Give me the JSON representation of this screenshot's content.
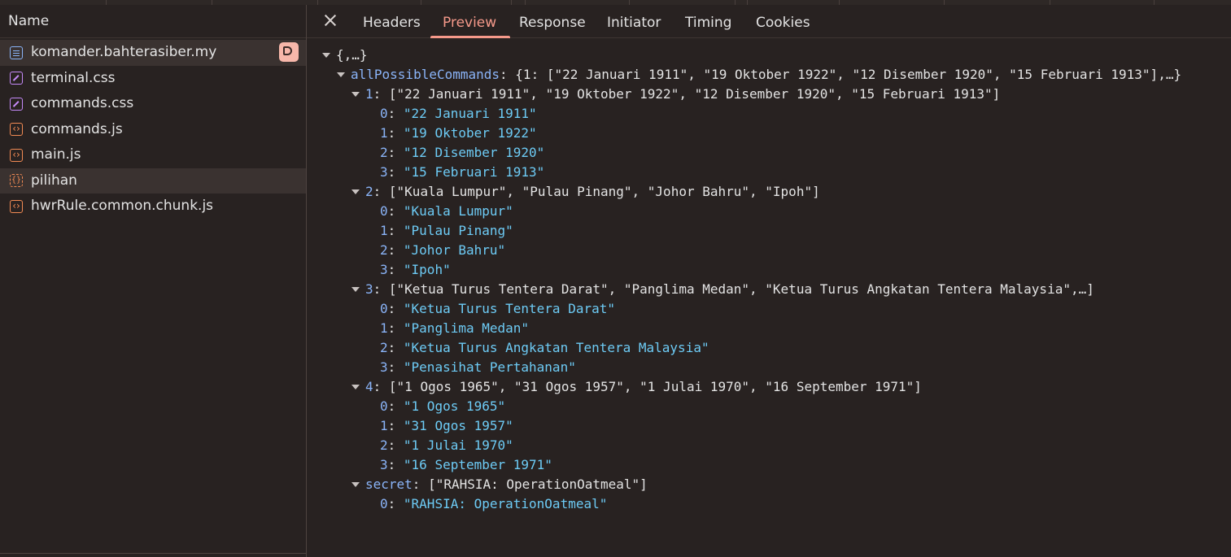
{
  "left_panel": {
    "header": "Name",
    "files": [
      {
        "name": "komander.bahterasiber.my",
        "type": "doc-icon"
      },
      {
        "name": "terminal.css",
        "type": "css-icon"
      },
      {
        "name": "commands.css",
        "type": "css-icon"
      },
      {
        "name": "commands.js",
        "type": "js-icon"
      },
      {
        "name": "main.js",
        "type": "js-icon"
      },
      {
        "name": "pilihan",
        "type": "json-icon"
      },
      {
        "name": "hwrRule.common.chunk.js",
        "type": "js-icon"
      }
    ]
  },
  "tabs": [
    "Headers",
    "Preview",
    "Response",
    "Initiator",
    "Timing",
    "Cookies"
  ],
  "active_tab": "Preview",
  "preview": {
    "root": "{,…}",
    "root_key": "allPossibleCommands",
    "root_summary": "{1: [\"22 Januari 1911\", \"19 Oktober 1922\", \"12 Disember 1920\", \"15 Februari 1913\"],…}",
    "groups": [
      {
        "key": "1",
        "summary": "[\"22 Januari 1911\", \"19 Oktober 1922\", \"12 Disember 1920\", \"15 Februari 1913\"]",
        "items": [
          "\"22 Januari 1911\"",
          "\"19 Oktober 1922\"",
          "\"12 Disember 1920\"",
          "\"15 Februari 1913\""
        ]
      },
      {
        "key": "2",
        "summary": "[\"Kuala Lumpur\", \"Pulau Pinang\", \"Johor Bahru\", \"Ipoh\"]",
        "items": [
          "\"Kuala Lumpur\"",
          "\"Pulau Pinang\"",
          "\"Johor Bahru\"",
          "\"Ipoh\""
        ]
      },
      {
        "key": "3",
        "summary": "[\"Ketua Turus Tentera Darat\", \"Panglima Medan\", \"Ketua Turus Angkatan Tentera Malaysia\",…]",
        "items": [
          "\"Ketua Turus Tentera Darat\"",
          "\"Panglima Medan\"",
          "\"Ketua Turus Angkatan Tentera Malaysia\"",
          "\"Penasihat Pertahanan\""
        ]
      },
      {
        "key": "4",
        "summary": "[\"1 Ogos 1965\", \"31 Ogos 1957\", \"1 Julai 1970\", \"16 September 1971\"]",
        "items": [
          "\"1 Ogos 1965\"",
          "\"31 Ogos 1957\"",
          "\"1 Julai 1970\"",
          "\"16 September 1971\""
        ]
      }
    ],
    "secret": {
      "key": "secret",
      "summary": "[\"RAHSIA: OperationOatmeal\"]",
      "items": [
        "\"RAHSIA: OperationOatmeal\""
      ]
    }
  }
}
